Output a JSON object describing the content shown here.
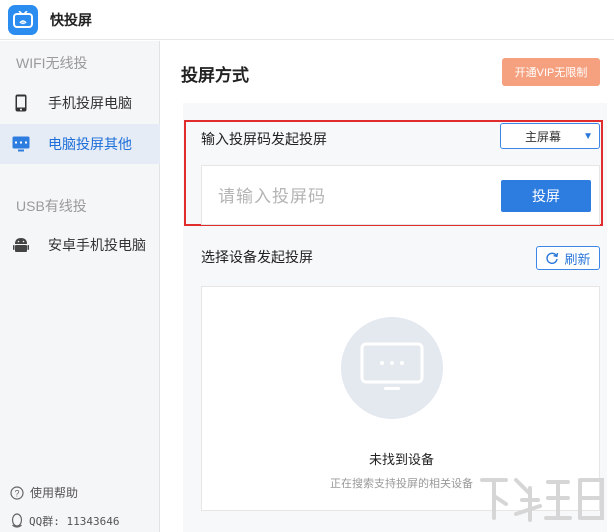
{
  "app": {
    "title": "快投屏"
  },
  "sidebar": {
    "wifi_section": "WIFI无线投",
    "usb_section": "USB有线投",
    "items": [
      {
        "label": "手机投屏电脑",
        "icon": "phone-icon",
        "active": false
      },
      {
        "label": "电脑投屏其他",
        "icon": "monitor-icon",
        "active": true
      },
      {
        "label": "安卓手机投电脑",
        "icon": "android-icon",
        "active": false
      }
    ],
    "help_label": "使用帮助",
    "qq_label": "QQ群: 11343646"
  },
  "main": {
    "title": "投屏方式",
    "vip_button": "开通VIP无限制",
    "code_section": {
      "title": "输入投屏码发起投屏",
      "screen_select": "主屏幕",
      "input_placeholder": "请输入投屏码",
      "cast_button": "投屏"
    },
    "device_section": {
      "title": "选择设备发起投屏",
      "refresh_button": "刷新",
      "empty_title": "未找到设备",
      "empty_subtitle": "正在搜索支持投屏的相关设备"
    }
  },
  "colors": {
    "accent": "#2d7de0",
    "vip": "#f5a07f",
    "highlight": "#e02c2c",
    "sidebar_bg": "#f5f6f8",
    "active_bg": "#e6ecf5"
  }
}
